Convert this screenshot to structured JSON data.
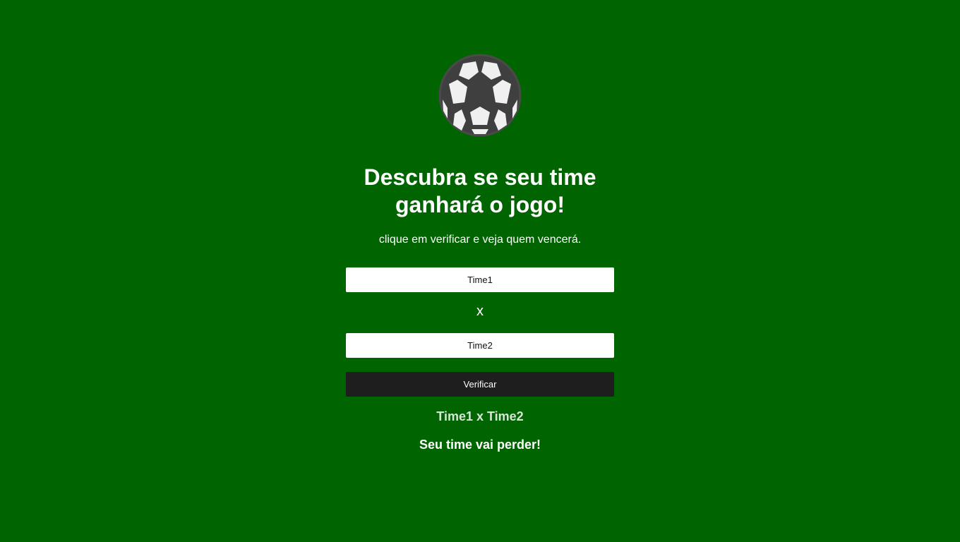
{
  "header": {
    "icon": "soccer-ball-icon",
    "title": "Descubra se seu time ganhará o jogo!",
    "subtitle": "clique em verificar e veja quem vencerá."
  },
  "form": {
    "team1_value": "Time1",
    "versus": "x",
    "team2_value": "Time2",
    "verify_label": "Verificar"
  },
  "result": {
    "matchup": "Time1 x Time2",
    "message": "Seu time vai perder!"
  },
  "colors": {
    "background": "#006400",
    "button": "#1e1e1e",
    "ball_dark": "#3f3f3f",
    "ball_light": "#f0f0f0"
  }
}
